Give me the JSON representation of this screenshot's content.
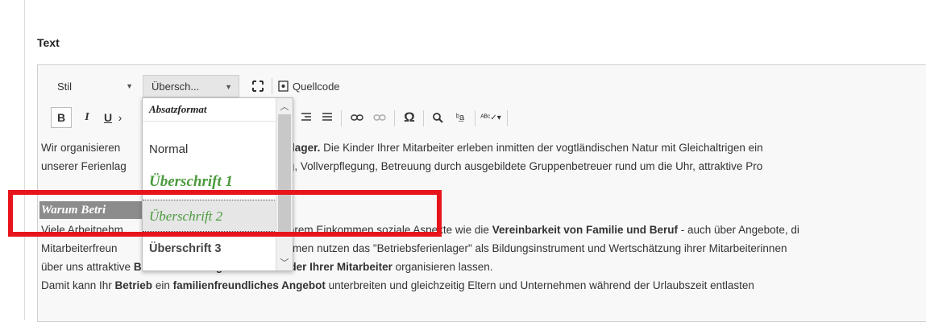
{
  "section": {
    "label": "Text"
  },
  "toolbar": {
    "style_label": "Stil",
    "format_label": "Übersch...",
    "maximize_icon": "maximize-icon",
    "source_label": "Quellcode",
    "bold": "B",
    "italic": "I",
    "underline": "U"
  },
  "dropdown": {
    "header": "Absatzformat",
    "items": [
      "Normal",
      "Überschrift 1",
      "Überschrift 2",
      "Überschrift 3"
    ],
    "selected": "Überschrift 2"
  },
  "content": {
    "line1_a": "Wir organisieren",
    "line1_b": "ferienlager.",
    "line1_c": " Die Kinder Ihrer Mitarbeiter erleben inmitten der vogtländischen Natur mit Gleichaltrigen ein",
    "line2_a": "unserer Ferienlag",
    "line2_b": "chtung, Vollverpflegung, Betreuung durch ausgebildete Gruppenbetreuer rund um die Uhr, attraktive Pro",
    "heading": "Warum Betri",
    "line4_a": "Viele Arbeitnehm",
    "line4_b": "ihrem Einkommen soziale Aspekte wie die ",
    "line4_c": "Vereinbarkeit von Familie und Beruf",
    "line4_d": " - auch über Angebote, di",
    "line5_a": "Mitarbeiterfreun",
    "line5_b": "hmen nutzen das \"Betriebsferienlager\" als Bildungsinstrument und Wertschätzung ihrer Mitarbeiterinnen",
    "line6_a": "über uns attraktive ",
    "line6_b": "Betriebsferienlager für die Kinder Ihrer Mitarbeiter",
    "line6_c": " organisieren lassen.",
    "line7_a": "Damit kann Ihr ",
    "line7_b": "Betrieb",
    "line7_c": " ein ",
    "line7_d": "familienfreundliches Angebot",
    "line7_e": " unterbreiten und gleichzeitig Eltern und Unternehmen während der Urlaubszeit entlasten"
  },
  "colors": {
    "highlight": "#e8141b",
    "heading_green": "#4a9a3c"
  }
}
